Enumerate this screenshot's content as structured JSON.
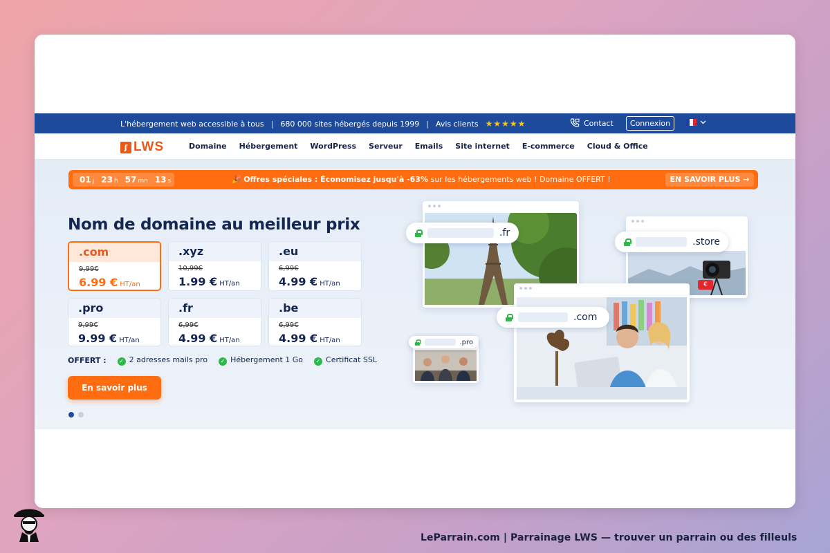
{
  "topbar": {
    "tagline": "L'hébergement web accessible à tous",
    "sites": "680 000 sites hébergés depuis 1999",
    "reviews_label": "Avis clients",
    "stars": "★★★★★",
    "separator": "|",
    "contact": "Contact",
    "login": "Connexion"
  },
  "nav": {
    "logo_mark": "ʃ",
    "logo_text": "LWS",
    "items": [
      "Domaine",
      "Hébergement",
      "WordPress",
      "Serveur",
      "Emails",
      "Site internet",
      "E-commerce",
      "Cloud & Office"
    ]
  },
  "promo": {
    "days": "01",
    "days_unit": "j",
    "hours": "23",
    "hours_unit": "h",
    "minutes": "57",
    "minutes_unit": "mn",
    "seconds": "13",
    "seconds_unit": "s",
    "icon": "🎉",
    "bold_text": "Offres spéciales : Économisez jusqu'à -63%",
    "text": " sur les hébergements web ! Domaine OFFERT !",
    "button": "EN SAVOIR PLUS →"
  },
  "hero": {
    "title": "Nom de domaine au meilleur prix",
    "tlds": [
      {
        "name": ".com",
        "old": "9,99€",
        "price": "6.99 €",
        "unit": "HT/an",
        "active": true
      },
      {
        "name": ".xyz",
        "old": "10,99€",
        "price": "1.99 €",
        "unit": "HT/an"
      },
      {
        "name": ".eu",
        "old": "6,99€",
        "price": "4.99 €",
        "unit": "HT/an"
      },
      {
        "name": ".pro",
        "old": "9,99€",
        "price": "9.99 €",
        "unit": "HT/an"
      },
      {
        "name": ".fr",
        "old": "6,99€",
        "price": "4.99 €",
        "unit": "HT/an"
      },
      {
        "name": ".be",
        "old": "6,99€",
        "price": "4.99 €",
        "unit": "HT/an"
      }
    ],
    "offers_label": "OFFERT :",
    "offers": [
      "2 adresses mails pro",
      "Hébergement 1 Go",
      "Certificat SSL"
    ],
    "cta": "En savoir plus"
  },
  "illustration": {
    "fr": ".fr",
    "store": ".store",
    "com": ".com",
    "pro": ".pro",
    "euro": "€"
  },
  "footer": {
    "text": "LeParrain.com | Parrainage LWS — trouver un parrain ou des filleuls"
  },
  "colors": {
    "brand_orange": "#ff6d10",
    "brand_blue": "#1e4a9c",
    "navy_text": "#152651",
    "success_green": "#2db84a"
  }
}
